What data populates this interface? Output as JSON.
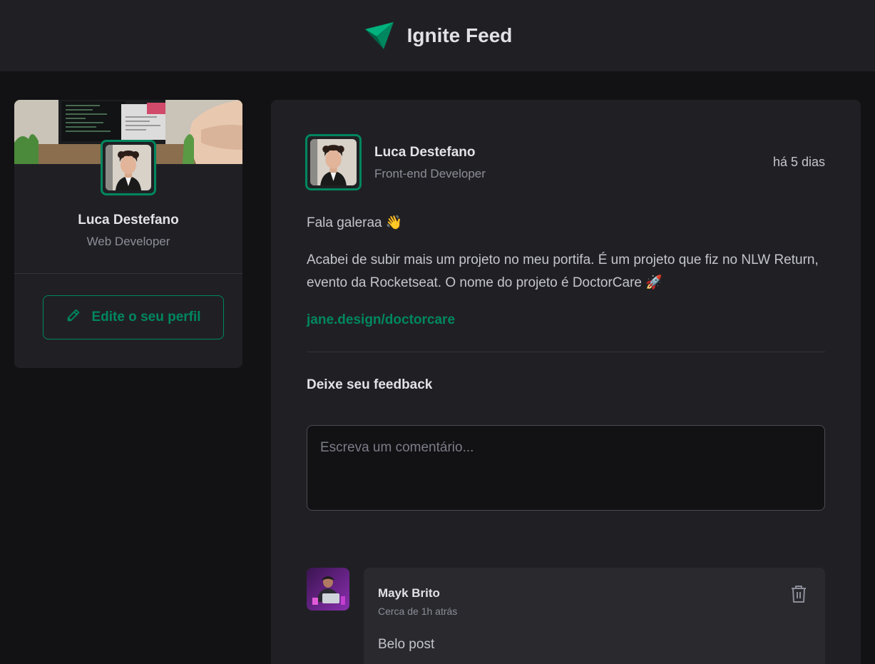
{
  "header": {
    "title": "Ignite Feed",
    "logo_icon": "ignite-logo-icon",
    "accent": "#00875f"
  },
  "sidebar": {
    "name": "Luca Destefano",
    "role": "Web Developer",
    "edit_button_label": "Edite o seu perfil",
    "edit_icon": "pencil-icon"
  },
  "post": {
    "author": "Luca Destefano",
    "role": "Front-end Developer",
    "time": "há 5 dias",
    "greeting": "Fala galeraa",
    "greeting_emoji": "👋",
    "body": "Acabei de subir mais um projeto no meu portifa. É um projeto que fiz no NLW Return, evento da Rocketseat. O nome do projeto é DoctorCare",
    "body_emoji": "🚀",
    "link": "jane.design/doctorcare"
  },
  "feedback": {
    "title": "Deixe seu feedback",
    "placeholder": "Escreva um comentário..."
  },
  "comments": [
    {
      "author": "Mayk Brito",
      "time": "Cerca de 1h atrás",
      "text": "Belo post",
      "delete_icon": "trash-icon"
    }
  ],
  "colors": {
    "background": "#121214",
    "surface": "#202024",
    "card": "#29292e",
    "accent": "#00875f"
  }
}
